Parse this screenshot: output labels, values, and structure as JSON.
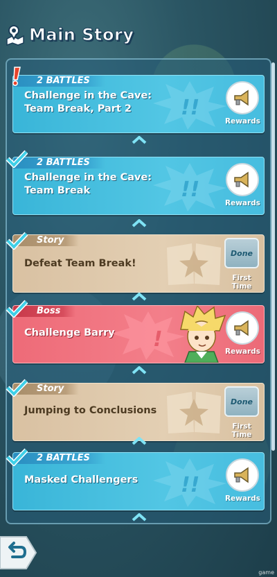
{
  "header": {
    "title": "Main Story",
    "icon": "story-map-pin-icon"
  },
  "stories": [
    {
      "tag": "2 BATTLES",
      "title_line1": "Challenge in the Cave:",
      "title_line2": "Team Break, Part 2",
      "variant": "blue",
      "status": "new",
      "action_label": "Rewards"
    },
    {
      "tag": "2 BATTLES",
      "title_line1": "Challenge in the Cave:",
      "title_line2": "Team Break",
      "variant": "blue",
      "status": "cleared",
      "action_label": "Rewards"
    },
    {
      "tag": "Story",
      "title_line1": "Defeat Team Break!",
      "variant": "story",
      "status": "cleared",
      "action_badge": "Done",
      "action_label": "First Time"
    },
    {
      "tag": "Boss",
      "title_line1": "Challenge Barry",
      "variant": "boss",
      "status": "cleared",
      "action_label": "Rewards"
    },
    {
      "tag": "Story",
      "title_line1": "Jumping to Conclusions",
      "variant": "story",
      "status": "cleared",
      "action_badge": "Done",
      "action_label": "First Time"
    },
    {
      "tag": "2 BATTLES",
      "title_line1": "Masked Challengers",
      "variant": "blue",
      "status": "cleared",
      "action_label": "Rewards"
    }
  ],
  "footer": {
    "back_icon": "back-arrow-icon",
    "note": "game"
  },
  "colors": {
    "accent_blue": "#47bddf",
    "story_tan": "#e3cfb3",
    "boss_red": "#f37f8a",
    "check_cyan": "#3fd0e8",
    "alert_red": "#e8432b"
  }
}
